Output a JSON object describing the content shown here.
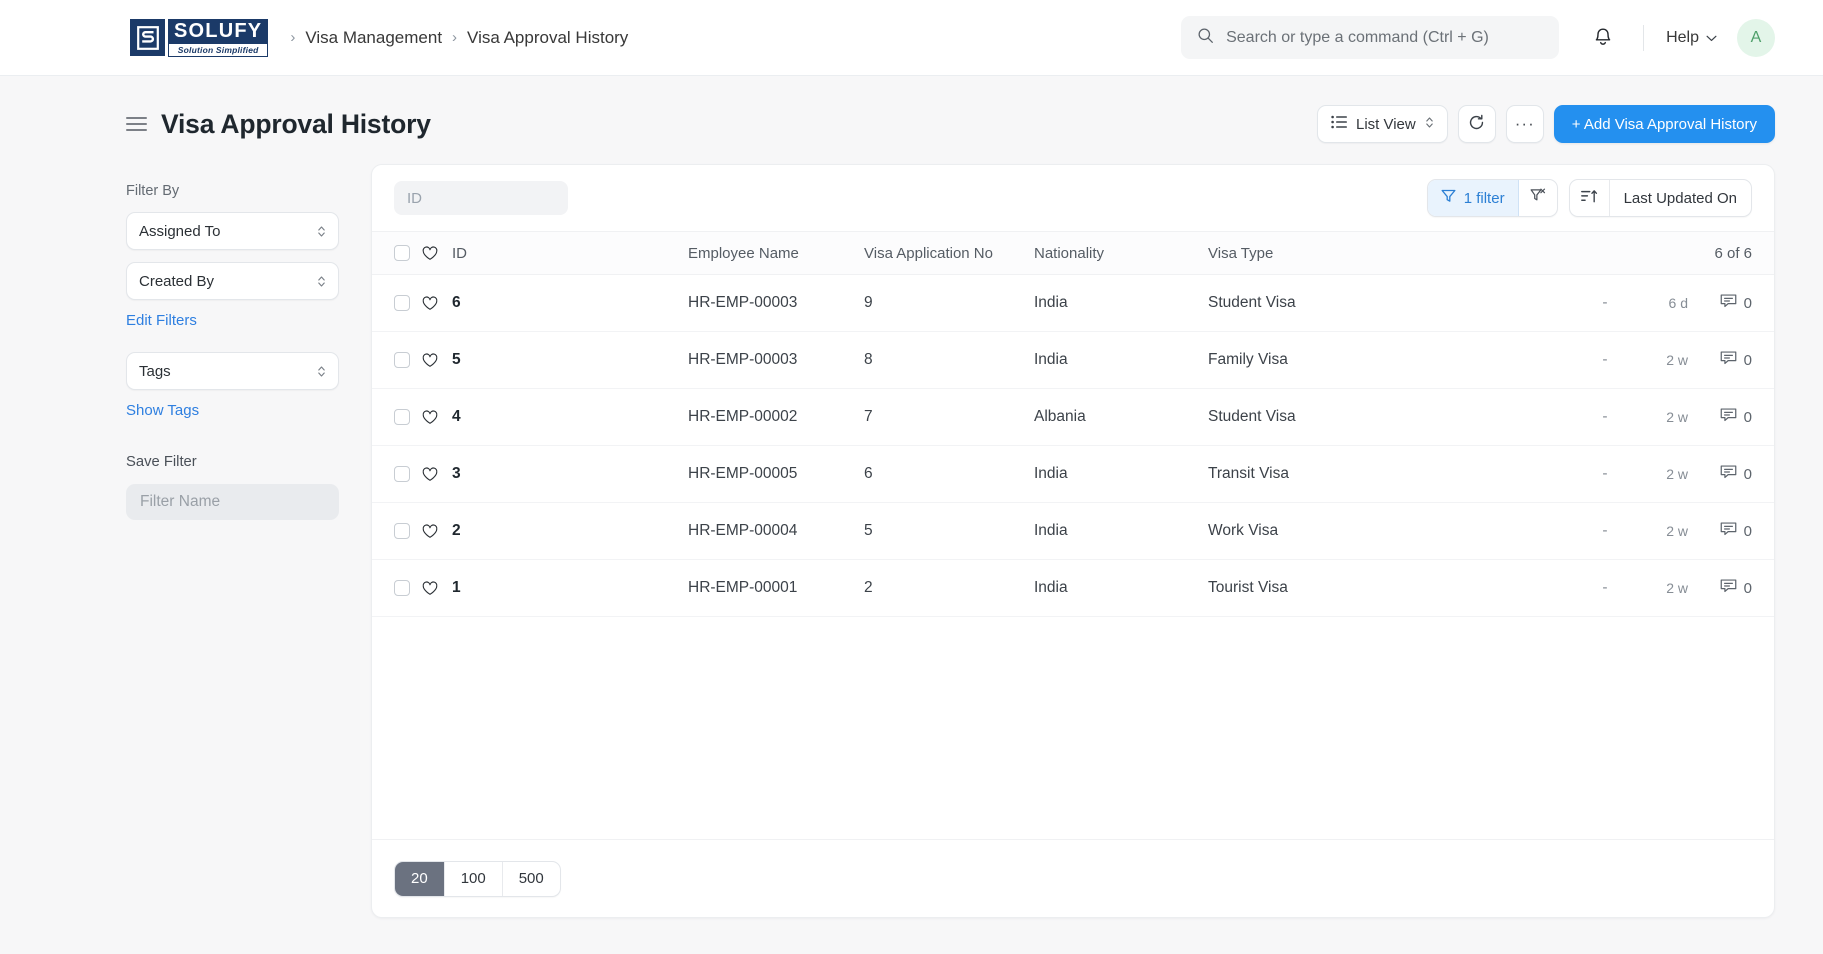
{
  "navbar": {
    "logo": {
      "word": "SOLUFY",
      "tagline": "Solution Simplified",
      "mark_letter": "S"
    },
    "breadcrumb": {
      "sep": "›",
      "items": [
        "Visa Management",
        "Visa Approval History"
      ]
    },
    "search": {
      "placeholder": "Search or type a command (Ctrl + G)",
      "value": ""
    },
    "help_label": "Help",
    "avatar_initial": "A"
  },
  "page": {
    "title": "Visa Approval History",
    "list_view_label": "List View",
    "add_button_label": "+ Add Visa Approval History",
    "more_label": "···"
  },
  "sidebar": {
    "filter_by_label": "Filter By",
    "filters": [
      {
        "label": "Assigned To"
      },
      {
        "label": "Created By"
      }
    ],
    "edit_filters_label": "Edit Filters",
    "tags_label": "Tags",
    "show_tags_label": "Show Tags",
    "save_filter_label": "Save Filter",
    "filter_name_placeholder": "Filter Name",
    "filter_name_value": ""
  },
  "toolbar": {
    "id_placeholder": "ID",
    "id_value": "",
    "filter_count_label": "1 filter",
    "sort_label": "Last Updated On"
  },
  "table": {
    "columns": [
      "ID",
      "Employee Name",
      "Visa Application No",
      "Nationality",
      "Visa Type"
    ],
    "count_label": "6 of 6",
    "rows": [
      {
        "id": "6",
        "employee": "HR-EMP-00003",
        "application_no": "9",
        "nationality": "India",
        "visa_type": "Student Visa",
        "assigned": "-",
        "modified": "6 d",
        "comments": "0"
      },
      {
        "id": "5",
        "employee": "HR-EMP-00003",
        "application_no": "8",
        "nationality": "India",
        "visa_type": "Family Visa",
        "assigned": "-",
        "modified": "2 w",
        "comments": "0"
      },
      {
        "id": "4",
        "employee": "HR-EMP-00002",
        "application_no": "7",
        "nationality": "Albania",
        "visa_type": "Student Visa",
        "assigned": "-",
        "modified": "2 w",
        "comments": "0"
      },
      {
        "id": "3",
        "employee": "HR-EMP-00005",
        "application_no": "6",
        "nationality": "India",
        "visa_type": "Transit Visa",
        "assigned": "-",
        "modified": "2 w",
        "comments": "0"
      },
      {
        "id": "2",
        "employee": "HR-EMP-00004",
        "application_no": "5",
        "nationality": "India",
        "visa_type": "Work Visa",
        "assigned": "-",
        "modified": "2 w",
        "comments": "0"
      },
      {
        "id": "1",
        "employee": "HR-EMP-00001",
        "application_no": "2",
        "nationality": "India",
        "visa_type": "Tourist Visa",
        "assigned": "-",
        "modified": "2 w",
        "comments": "0"
      }
    ]
  },
  "pagination": {
    "options": [
      "20",
      "100",
      "500"
    ],
    "active": "20"
  },
  "colors": {
    "primary": "#2490ef",
    "brand_navy": "#1b3a68",
    "link": "#2e7fe0",
    "filter_chip_bg": "#e9f3fd",
    "filter_chip_text": "#2b7fd4",
    "avatar_bg": "#e3f5e9",
    "avatar_text": "#4e9f6a",
    "page_bg": "#f7f7f8",
    "pager_active_bg": "#6b7280"
  }
}
